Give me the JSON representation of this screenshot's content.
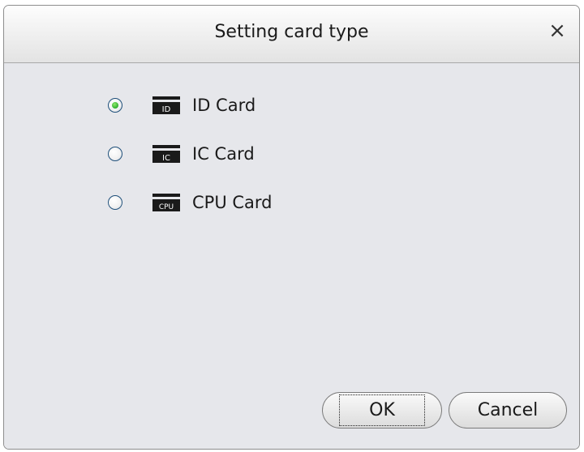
{
  "dialog": {
    "title": "Setting card type",
    "close_symbol": "×"
  },
  "options": [
    {
      "label": "ID Card",
      "icon": "id-card-icon",
      "icon_text": "ID",
      "selected": true
    },
    {
      "label": "IC Card",
      "icon": "ic-card-icon",
      "icon_text": "IC",
      "selected": false
    },
    {
      "label": "CPU Card",
      "icon": "cpu-card-icon",
      "icon_text": "CPU",
      "selected": false
    }
  ],
  "buttons": {
    "ok_label": "OK",
    "cancel_label": "Cancel"
  },
  "colors": {
    "radio_selected": "#2fae2f",
    "dialog_background": "#e6e7eb",
    "icon_dark": "#1a1a1a"
  }
}
